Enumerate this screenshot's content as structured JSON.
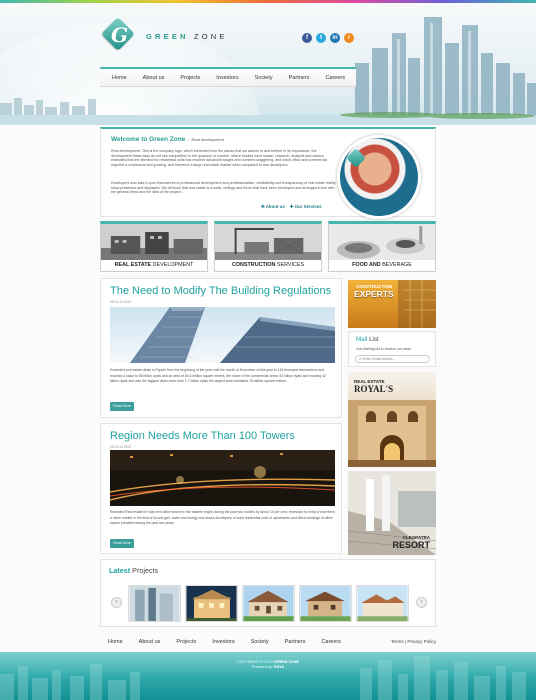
{
  "site": {
    "logo_letter": "G",
    "logo_name_a": "GREEN",
    "logo_name_b": "ZONE",
    "social": [
      {
        "name": "facebook-icon",
        "glyph": "f",
        "color": "#3b5998"
      },
      {
        "name": "twitter-icon",
        "glyph": "t",
        "color": "#29a9df"
      },
      {
        "name": "linkedin-icon",
        "glyph": "in",
        "color": "#1d75b3"
      },
      {
        "name": "rss-icon",
        "glyph": "r",
        "color": "#f2891b"
      }
    ],
    "accent": "#45b8ae"
  },
  "nav": [
    "Home",
    "About us",
    "Projects",
    "Investors",
    "Society",
    "Partners",
    "Careers"
  ],
  "welcome": {
    "title": "Welcome to Green Zone",
    "subtitle": "... Real development",
    "para1": "Real development .This is the company logo, which stemmed from the values that we adhere to and believe in its importance, the development these days do not see competition in the quantum or number, where studies have shown; research, analysis and various estimates that the demand for residential units has reached advanced stages and numbers staggering, and notch office and commercial required a continuous and growing, and therefore a large real estate market when compared to real developers.",
    "para2": "Developers who take it upon themselves to professional development and professionalism, creditability and transparency of real estate reality show presented and displayed. We all know that real estate is a walls, ceilings and floors that have been developed and arranged in line with the general trend and the idea of the project ...",
    "link_about": "About us",
    "link_services": "Our Services"
  },
  "services": [
    {
      "bold": "REAL ESTATE",
      "rest": "DEVELOPMENT"
    },
    {
      "bold": "CONSTRUCTION",
      "rest": "SERVICES"
    },
    {
      "bold": "FOOD AND",
      "rest": "BEVERAGE"
    }
  ],
  "posts": [
    {
      "title": "The Need to Modify The Building Regulations",
      "date": "09.01.13 2013",
      "text": "Exceeded real estate deals in Riyadh from the beginning of the year until the month of November of this year to 140 thousand transactions and reached a value to 85 billion riyals and an area of 84.5 million square meters, the share of the commercial sector 43 billion riyals and housing 42 billion riyals and was the biggest deals more than 1.7 billion riyals the largest area estimated 15 million square meters.",
      "button": "Read More"
    },
    {
      "title": "Region Needs More Than 100 Towers",
      "date": "09.01.13 2013",
      "text": "Revealed Real estate for high-rent office towers in the eastern region during the past two months by about 10 per cent, recession to entry of new firms a niche market in the field of oil and gas, water and energy and draws developers to build residential units of apartments and office buildings of office towers prevailed during the past two years.",
      "button": "Read More"
    }
  ],
  "sidebar": {
    "ad1_line1": "CONSTRUCTION",
    "ad1_line2": "EXPERTS",
    "mail_title_a": "Mail",
    "mail_title_b": "List",
    "mail_desc": "Join Mailing list to receive our news",
    "mail_placeholder": "Enter Email Adress...",
    "ad2_line1": "REAL ESTATE",
    "ad2_line2": "ROYAL'S",
    "ad3_line1": "CLEOPATRA",
    "ad3_line2": "RESORT"
  },
  "latest": {
    "title_a": "Latest",
    "title_b": "Projects",
    "prev": "‹",
    "next": "›"
  },
  "footer": {
    "links": [
      "Home",
      "About us",
      "Projects",
      "Investors",
      "Society",
      "Partners",
      "Careers"
    ],
    "terms": "Terms",
    "sep": "|",
    "privacy": "Privacy Policy",
    "copyright_a": "COPYRIGHT © 2013",
    "copyright_b": "GREEN ZONE",
    "powered_a": "Powered by:",
    "powered_b": "RAYA"
  }
}
